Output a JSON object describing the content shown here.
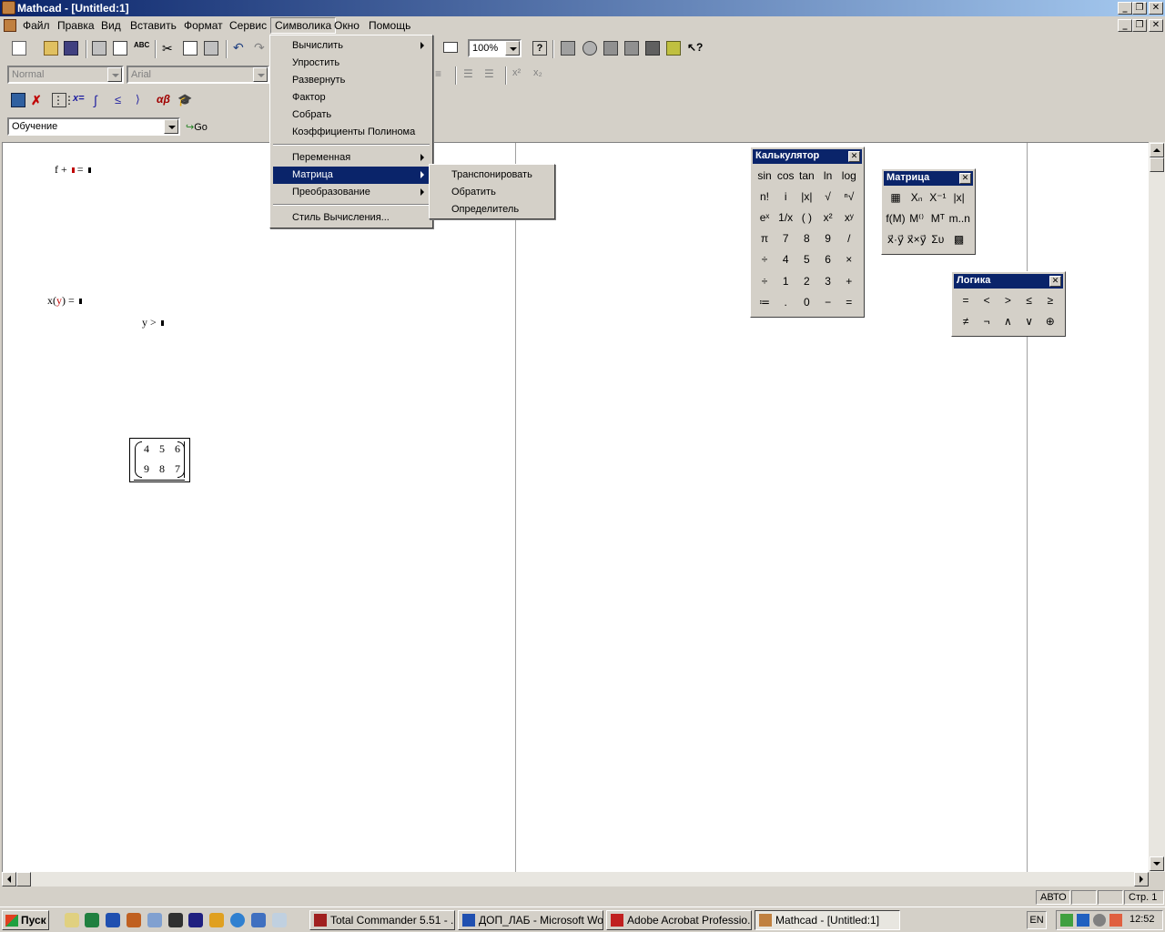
{
  "window": {
    "title": "Mathcad - [Untitled:1]"
  },
  "menubar": {
    "items": [
      {
        "label": "Файл"
      },
      {
        "label": "Правка"
      },
      {
        "label": "Вид"
      },
      {
        "label": "Вставить"
      },
      {
        "label": "Формат"
      },
      {
        "label": "Сервис"
      },
      {
        "label": "Символика"
      },
      {
        "label": "Окно"
      },
      {
        "label": "Помощь"
      }
    ],
    "active": "Символика"
  },
  "toolbar": {
    "zoom": "100%",
    "style_select": "Normal",
    "font_select": "Arial"
  },
  "resources": {
    "select_value": "Обучение",
    "go_label": "Go"
  },
  "symbolics_menu": {
    "items": [
      {
        "label": "Вычислить"
      },
      {
        "label": "Упростить"
      },
      {
        "label": "Развернуть"
      },
      {
        "label": "Фактор"
      },
      {
        "label": "Собрать"
      },
      {
        "label": "Коэффициенты Полинома"
      },
      {
        "label": "Переменная"
      },
      {
        "label": "Матрица"
      },
      {
        "label": "Преобразование"
      },
      {
        "label": "Стиль Вычисления..."
      }
    ],
    "highlighted": "Матрица"
  },
  "matrix_submenu": {
    "items": [
      {
        "label": "Транспонировать"
      },
      {
        "label": "Обратить"
      },
      {
        "label": "Определитель"
      }
    ]
  },
  "worksheet": {
    "expr1": {
      "a": "f",
      "b": "+",
      "c": "="
    },
    "expr2": {
      "fn": "x",
      "arg": "y",
      "eq": "="
    },
    "expr3": {
      "var": "y",
      "op": ">"
    },
    "matrix": {
      "row1": [
        "4",
        "5",
        "6"
      ],
      "row2": [
        "9",
        "8",
        "7"
      ]
    }
  },
  "calculator": {
    "title": "Калькулятор",
    "rows": [
      [
        "sin",
        "cos",
        "tan",
        "ln",
        "log"
      ],
      [
        "n!",
        "i",
        "|x|",
        "√",
        "ⁿ√"
      ],
      [
        "eˣ",
        "1/x",
        "( )",
        "x²",
        "xʸ"
      ],
      [
        "π",
        "7",
        "8",
        "9",
        "/"
      ],
      [
        "÷",
        "4",
        "5",
        "6",
        "×"
      ],
      [
        "÷",
        "1",
        "2",
        "3",
        "+"
      ],
      [
        "≔",
        ".",
        "0",
        "−",
        "="
      ]
    ]
  },
  "matrix_palette": {
    "title": "Матрица",
    "rows": [
      [
        "▦",
        "Xₙ",
        "X⁻¹",
        "|x|"
      ],
      [
        "f(M)",
        "M⁽⁾",
        "Mᵀ",
        "m..n"
      ],
      [
        "x⃗·y⃗",
        "x⃗×y⃗",
        "Συ",
        "▩"
      ]
    ]
  },
  "logic_palette": {
    "title": "Логика",
    "rows": [
      [
        "=",
        "<",
        ">",
        "≤",
        "≥"
      ],
      [
        "≠",
        "¬",
        "∧",
        "∨",
        "⊕"
      ]
    ]
  },
  "statusbar": {
    "mode": "АВТО",
    "page": "Стр. 1"
  },
  "taskbar": {
    "start_label": "Пуск",
    "tasks": [
      {
        "label": "Total Commander 5.51 - ..."
      },
      {
        "label": "ДОП_ЛАБ - Microsoft Word"
      },
      {
        "label": "Adobe Acrobat Professio..."
      },
      {
        "label": "Mathcad - [Untitled:1]"
      }
    ],
    "lang": "EN",
    "clock": "12:52"
  }
}
